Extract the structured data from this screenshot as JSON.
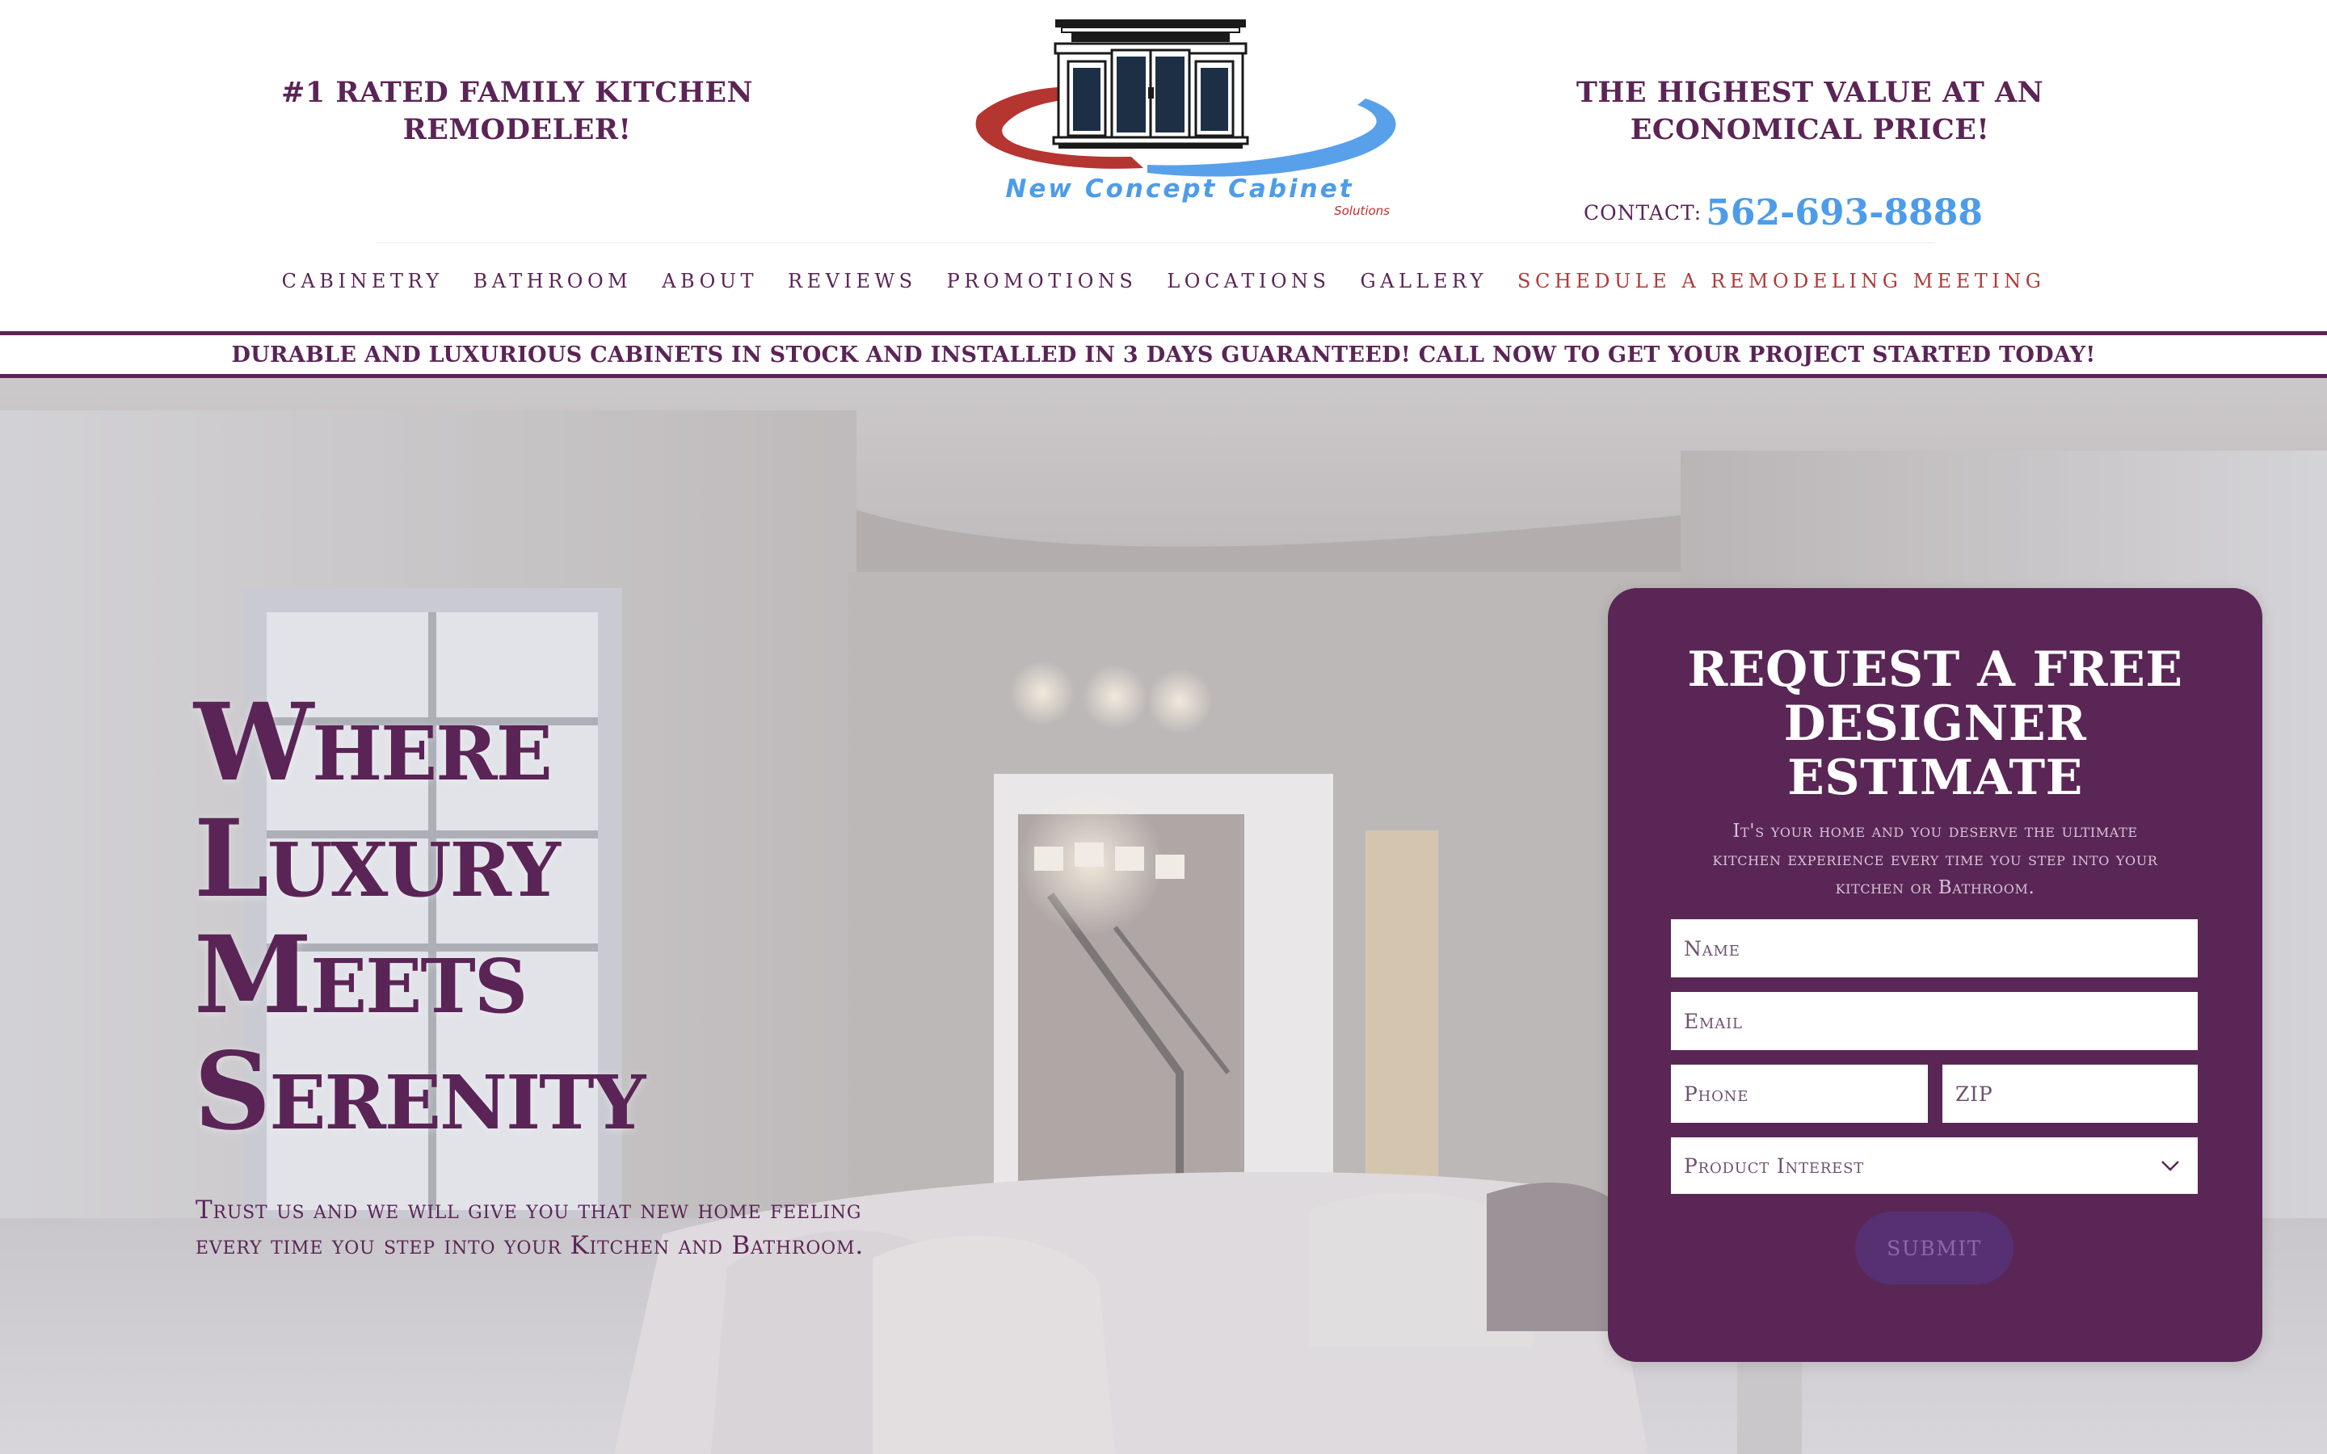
{
  "header": {
    "tagline_left": "#1 RATED FAMILY KITCHEN REMODELER!",
    "tagline_right": "THE HIGHEST VALUE AT AN ECONOMICAL PRICE!",
    "logo": {
      "name": "New Concept Cabinet",
      "sub": "Solutions"
    },
    "contact_label": "CONTACT:",
    "contact_phone": "562-693-8888"
  },
  "nav": {
    "items": [
      {
        "label": "CABINETRY"
      },
      {
        "label": "BATHROOM"
      },
      {
        "label": "ABOUT"
      },
      {
        "label": "REVIEWS"
      },
      {
        "label": "PROMOTIONS"
      },
      {
        "label": "LOCATIONS"
      },
      {
        "label": "GALLERY"
      },
      {
        "label": "SCHEDULE A REMODELING MEETING"
      }
    ]
  },
  "banner": {
    "text": "DURABLE AND LUXURIOUS CABINETS IN STOCK AND INSTALLED IN 3 DAYS GUARANTEED! CALL NOW TO GET YOUR PROJECT STARTED TODAY!"
  },
  "hero": {
    "title_lines": [
      "Where",
      "Luxury",
      "Meets",
      "Serenity"
    ],
    "subtitle_line1": "Trust us and we will give you that new home feeling",
    "subtitle_line2": "every time you step into your Kitchen and Bathroom."
  },
  "form": {
    "title_lines": [
      "REQUEST A FREE",
      "DESIGNER",
      "ESTIMATE"
    ],
    "description_line1": "It's your home and you deserve the ultimate",
    "description_line2": "kitchen experience every time you step into your",
    "description_line3": "kitchen or Bathroom.",
    "fields": {
      "name_placeholder": "Name",
      "email_placeholder": "Email",
      "phone_placeholder": "Phone",
      "zip_placeholder": "ZIP",
      "product_interest": "Product Interest"
    },
    "submit_label": "SUBMIT"
  },
  "colors": {
    "brand_purple": "#5b2456",
    "accent_blue": "#4d9ce9",
    "accent_red": "#b03a3a",
    "submit_bg": "#563072"
  },
  "icons": [
    "chevron-down-icon",
    "cabinet-logo-icon"
  ]
}
